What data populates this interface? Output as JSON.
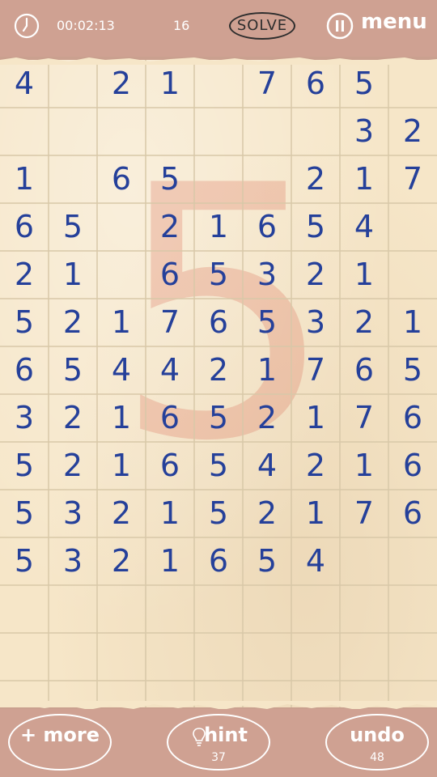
{
  "header": {
    "timer": "00:02:13",
    "moves": "16",
    "solve_label": "SOLVE",
    "menu_label": "menu"
  },
  "board": {
    "current_number": "5",
    "rows": [
      [
        "4",
        "",
        "2",
        "1",
        "",
        "7",
        "6",
        "5",
        ""
      ],
      [
        "",
        "",
        "",
        "",
        "",
        "",
        "",
        "3",
        "2"
      ],
      [
        "1",
        "",
        "6",
        "5",
        "",
        "",
        "2",
        "1",
        "7"
      ],
      [
        "6",
        "5",
        "",
        "2",
        "1",
        "6",
        "5",
        "4",
        ""
      ],
      [
        "2",
        "1",
        "",
        "6",
        "5",
        "3",
        "2",
        "1",
        ""
      ],
      [
        "5",
        "2",
        "1",
        "7",
        "6",
        "5",
        "3",
        "2",
        "1"
      ],
      [
        "6",
        "5",
        "4",
        "4",
        "2",
        "1",
        "7",
        "6",
        "5"
      ],
      [
        "3",
        "2",
        "1",
        "6",
        "5",
        "2",
        "1",
        "7",
        "6"
      ],
      [
        "5",
        "2",
        "1",
        "6",
        "5",
        "4",
        "2",
        "1",
        "6"
      ],
      [
        "5",
        "3",
        "2",
        "1",
        "5",
        "2",
        "1",
        "7",
        "6"
      ],
      [
        "5",
        "3",
        "2",
        "1",
        "6",
        "5",
        "4",
        "",
        ""
      ],
      [
        "",
        "",
        "",
        "",
        "",
        "",
        "",
        "",
        ""
      ],
      [
        "",
        "",
        "",
        "",
        "",
        "",
        "",
        "",
        ""
      ],
      [
        "",
        "",
        "",
        "",
        "",
        "",
        "",
        "",
        ""
      ]
    ]
  },
  "footer": {
    "more_label": "+ more",
    "hint_label": "hint",
    "hint_count": "37",
    "undo_label": "undo",
    "undo_count": "48"
  },
  "colors": {
    "bar": "#cfa192",
    "paper": "#f6e6c8",
    "ink": "#25409a",
    "grid_line": "#d8c8a8"
  }
}
